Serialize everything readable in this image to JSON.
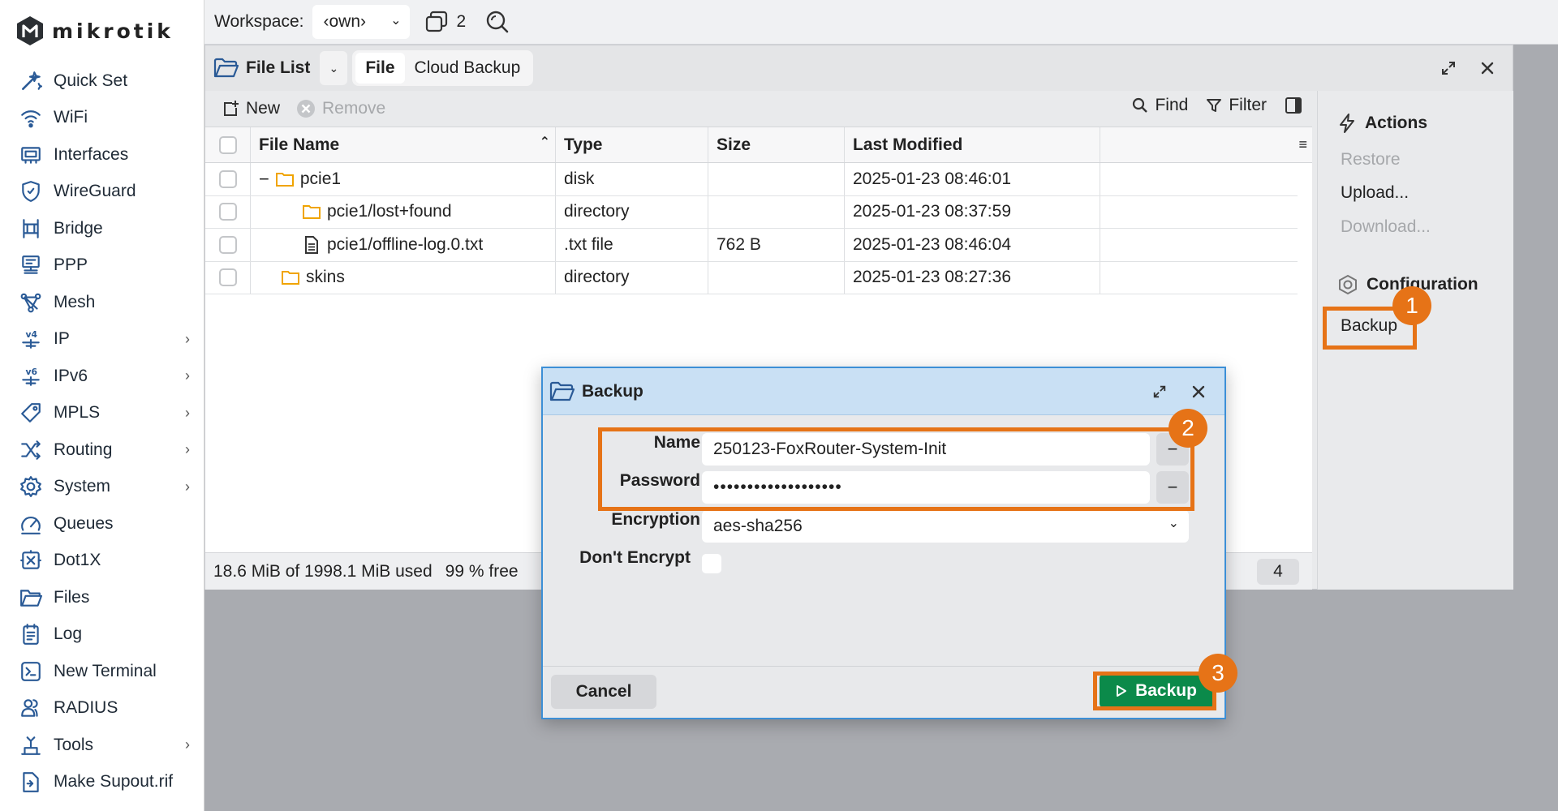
{
  "brand": {
    "logo_text": "mikrotik"
  },
  "sidebar": {
    "items": [
      {
        "label": "Quick Set",
        "icon": "wand-icon",
        "has_submenu": false
      },
      {
        "label": "WiFi",
        "icon": "wifi-icon",
        "has_submenu": false
      },
      {
        "label": "Interfaces",
        "icon": "interfaces-icon",
        "has_submenu": false
      },
      {
        "label": "WireGuard",
        "icon": "shield-icon",
        "has_submenu": false
      },
      {
        "label": "Bridge",
        "icon": "bridge-icon",
        "has_submenu": false
      },
      {
        "label": "PPP",
        "icon": "ppp-icon",
        "has_submenu": false
      },
      {
        "label": "Mesh",
        "icon": "mesh-icon",
        "has_submenu": false
      },
      {
        "label": "IP",
        "icon": "ipv4-icon",
        "has_submenu": true
      },
      {
        "label": "IPv6",
        "icon": "ipv6-icon",
        "has_submenu": true
      },
      {
        "label": "MPLS",
        "icon": "tag-icon",
        "has_submenu": true
      },
      {
        "label": "Routing",
        "icon": "routing-icon",
        "has_submenu": true
      },
      {
        "label": "System",
        "icon": "gear-icon",
        "has_submenu": true
      },
      {
        "label": "Queues",
        "icon": "gauge-icon",
        "has_submenu": false
      },
      {
        "label": "Dot1X",
        "icon": "dot1x-icon",
        "has_submenu": false
      },
      {
        "label": "Files",
        "icon": "folder-icon",
        "has_submenu": false
      },
      {
        "label": "Log",
        "icon": "log-icon",
        "has_submenu": false
      },
      {
        "label": "New Terminal",
        "icon": "terminal-icon",
        "has_submenu": false
      },
      {
        "label": "RADIUS",
        "icon": "users-icon",
        "has_submenu": false
      },
      {
        "label": "Tools",
        "icon": "tools-icon",
        "has_submenu": true
      },
      {
        "label": "Make Supout.rif",
        "icon": "file-export-icon",
        "has_submenu": false
      }
    ]
  },
  "topbar": {
    "workspace_label": "Workspace:",
    "workspace_value": "‹own›",
    "window_count": "2"
  },
  "file_list": {
    "title": "File List",
    "tabs": [
      {
        "label": "File",
        "active": true
      },
      {
        "label": "Cloud Backup",
        "active": false
      }
    ],
    "toolbar": {
      "new_label": "New",
      "remove_label": "Remove",
      "find_label": "Find",
      "filter_label": "Filter"
    },
    "columns": {
      "name": "File Name",
      "type": "Type",
      "size": "Size",
      "modified": "Last Modified"
    },
    "rows": [
      {
        "name": "pcie1",
        "type": "disk",
        "size": "",
        "modified": "2025-01-23 08:46:01"
      },
      {
        "name": "pcie1/lost+found",
        "type": "directory",
        "size": "",
        "modified": "2025-01-23 08:37:59"
      },
      {
        "name": "pcie1/offline-log.0.txt",
        "type": ".txt file",
        "size": "762 B",
        "modified": "2025-01-23 08:46:04"
      },
      {
        "name": "skins",
        "type": "directory",
        "size": "",
        "modified": "2025-01-23 08:27:36"
      }
    ],
    "status": {
      "usage": "18.6 MiB of 1998.1 MiB  used",
      "free": "99 % free",
      "count": "4"
    }
  },
  "actions_panel": {
    "actions_title": "Actions",
    "restore": "Restore",
    "upload": "Upload...",
    "download": "Download...",
    "config_title": "Configuration",
    "backup": "Backup"
  },
  "dialog": {
    "title": "Backup",
    "name_label": "Name",
    "name_value": "250123-FoxRouter-System-Init",
    "password_label": "Password",
    "password_value": "•••••••••••••••••••",
    "encryption_label": "Encryption",
    "encryption_value": "aes-sha256",
    "dont_encrypt_label": "Don't Encrypt",
    "cancel_label": "Cancel",
    "backup_label": "Backup"
  },
  "annotations": {
    "step1": "1",
    "step2": "2",
    "step3": "3"
  },
  "colors": {
    "accent_orange": "#e67317",
    "backup_green": "#0b8a4a",
    "dialog_header": "#c9e0f4",
    "icon_blue": "#2a5a96"
  }
}
